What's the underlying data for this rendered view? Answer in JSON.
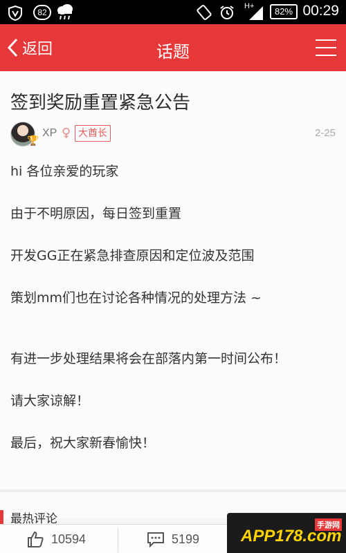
{
  "status_bar": {
    "notification_count": "82",
    "network": "H+",
    "battery": "82%",
    "time": "00:29"
  },
  "header": {
    "back_label": "返回",
    "title": "话题"
  },
  "post": {
    "title": "签到奖励重置紧急公告",
    "author": {
      "name": "XP",
      "rank": "大酋长"
    },
    "date": "2-25",
    "body": [
      "hi 各位亲爱的玩家",
      "由于不明原因，每日签到重置",
      "开发GG正在紧急排查原因和定位波及范围",
      "策划mm们也在讨论各种情况的处理方法 ~",
      "有进一步处理结果将会在部落内第一时间公布！",
      "请大家谅解！",
      "最后，祝大家新春愉快！"
    ]
  },
  "hot_comments": {
    "title": "最热评论"
  },
  "bottom_bar": {
    "likes": "10594",
    "comments": "5199"
  },
  "watermark": {
    "text": "APP178.com",
    "sub": "手游网"
  },
  "colors": {
    "accent": "#e63838",
    "status_bar": "#000000",
    "watermark_text": "#ffd400"
  },
  "icons": [
    "shield-v-icon",
    "cloud-rain-icon",
    "screen-rotate-icon",
    "alarm-clock-icon",
    "signal-icon",
    "battery-icon",
    "back-chevron-icon",
    "hamburger-menu-icon",
    "trophy-icon",
    "female-gender-icon",
    "thumbs-up-icon",
    "comment-icon"
  ]
}
